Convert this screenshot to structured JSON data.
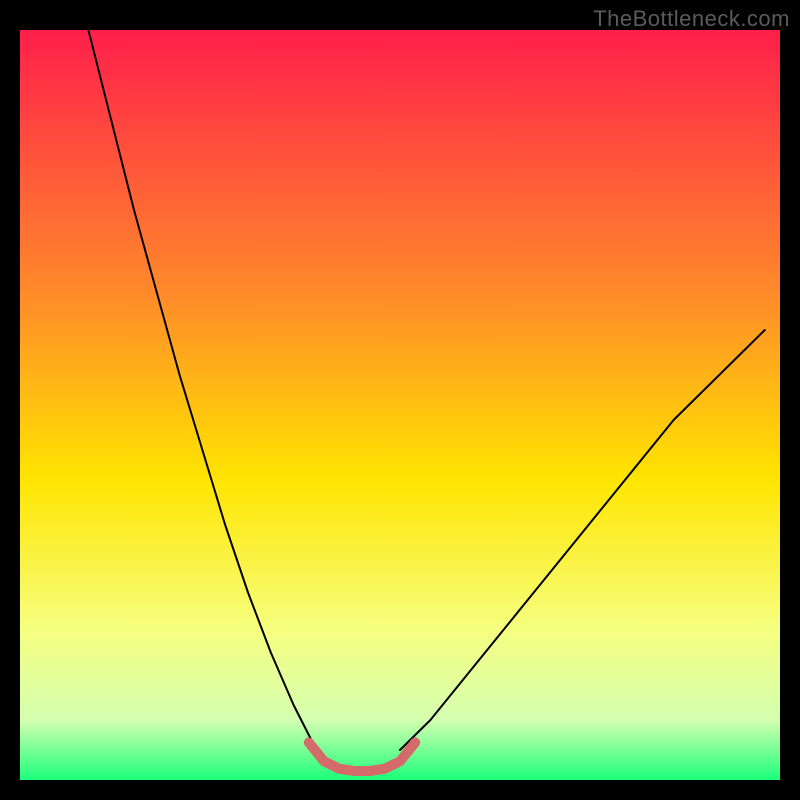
{
  "watermark": "TheBottleneck.com",
  "chart_data": {
    "type": "line",
    "title": "",
    "xlabel": "",
    "ylabel": "",
    "xlim": [
      0,
      100
    ],
    "ylim": [
      0,
      100
    ],
    "grid": false,
    "legend": false,
    "gradient_stops": [
      {
        "offset": 0,
        "color": "#ff1f4b"
      },
      {
        "offset": 35,
        "color": "#ff8a2a"
      },
      {
        "offset": 60,
        "color": "#ffe500"
      },
      {
        "offset": 80,
        "color": "#f6ff80"
      },
      {
        "offset": 92,
        "color": "#d4ffb0"
      },
      {
        "offset": 100,
        "color": "#1bff7a"
      }
    ],
    "series": [
      {
        "name": "bottleneck-curve-left",
        "color": "#000000",
        "width": 2,
        "x": [
          9,
          12,
          15,
          18,
          21,
          24,
          27,
          30,
          33,
          36,
          39
        ],
        "y": [
          100,
          88,
          76,
          65,
          54,
          44,
          34,
          25,
          17,
          10,
          4
        ]
      },
      {
        "name": "bottleneck-curve-right",
        "color": "#000000",
        "width": 2,
        "x": [
          50,
          54,
          58,
          62,
          66,
          70,
          74,
          78,
          82,
          86,
          90,
          94,
          98
        ],
        "y": [
          4,
          8,
          13,
          18,
          23,
          28,
          33,
          38,
          43,
          48,
          52,
          56,
          60
        ]
      },
      {
        "name": "bottleneck-floor-highlight",
        "color": "#d46a6a",
        "width": 10,
        "x": [
          38,
          40,
          42,
          44,
          46,
          48,
          50,
          52
        ],
        "y": [
          5,
          2.5,
          1.5,
          1.2,
          1.2,
          1.5,
          2.5,
          5
        ]
      }
    ]
  }
}
